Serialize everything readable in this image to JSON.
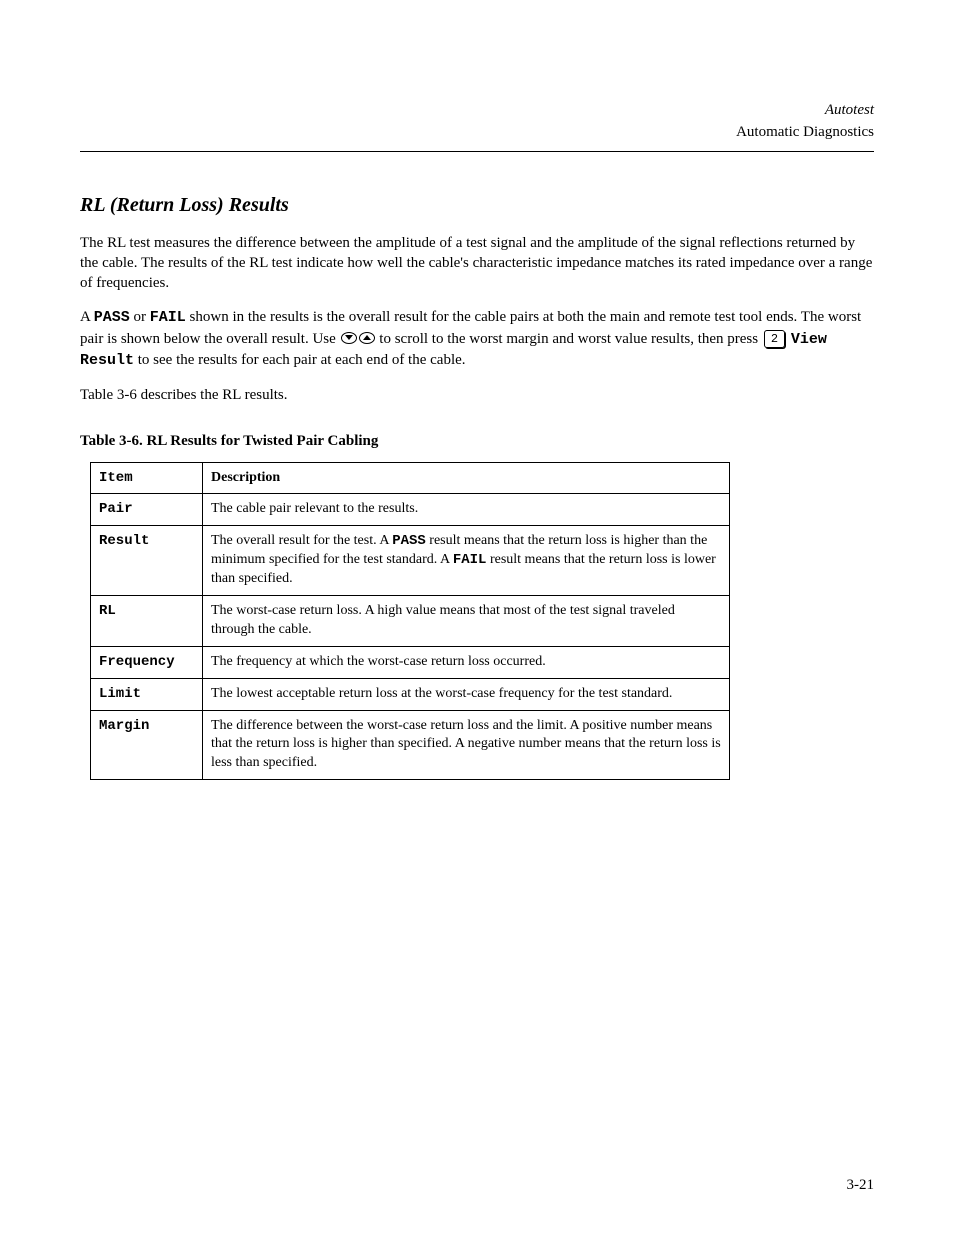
{
  "runningHead": {
    "line1": "Autotest",
    "line2": "Automatic Diagnostics"
  },
  "section": {
    "title": "RL (Return Loss) Results",
    "p1_a": "The RL test measures the difference between the amplitude of a test signal and the amplitude of the signal reflections returned by the cable. The results of the RL test indicate how well the cable's characteristic impedance matches its rated impedance over a range of frequencies.",
    "p2_a": "A ",
    "p2_pass": "PASS",
    "p2_b": " or ",
    "p2_fail": "FAIL",
    "p2_c": " shown in the results is the overall result for the cable pairs at both the main and remote test tool ends. The worst pair is shown below the overall result. Use ",
    "p2_d": " to scroll to the worst margin and worst value results, then press ",
    "p2_key": "2",
    "p2_viewresult": "View Result",
    "p2_e": " to see the results for each pair at each end of the cable."
  },
  "table": {
    "caption_a": "Table 3-6 describes the RL results. ",
    "caption_b": "Table 3-6. RL Results for Twisted Pair Cabling",
    "headers": {
      "item": "Item",
      "description": "Description"
    },
    "rows": {
      "pair": {
        "label": "Pair",
        "desc": "The cable pair relevant to the results."
      },
      "result": {
        "label": "Result",
        "desc_a": "The overall result for the test. A ",
        "pass": "PASS",
        "desc_b": " result means that the return loss is higher than the minimum specified for the test standard. A ",
        "fail": "FAIL",
        "desc_c": " result means that the return loss is lower than specified."
      },
      "rl": {
        "label": "RL",
        "desc": "The worst-case return loss. A high value means that most of the test signal traveled through the cable."
      },
      "frequency": {
        "label": "Frequency",
        "desc": "The frequency at which the worst-case return loss occurred."
      },
      "limit": {
        "label": "Limit",
        "desc": "The lowest acceptable return loss at the worst-case frequency for the test standard."
      },
      "margin": {
        "label": "Margin",
        "desc": "The difference between the worst-case return loss and the limit. A positive number means that the return loss is higher than specified. A negative number means that the return loss is less than specified."
      }
    }
  },
  "pageNumber": "3-21"
}
